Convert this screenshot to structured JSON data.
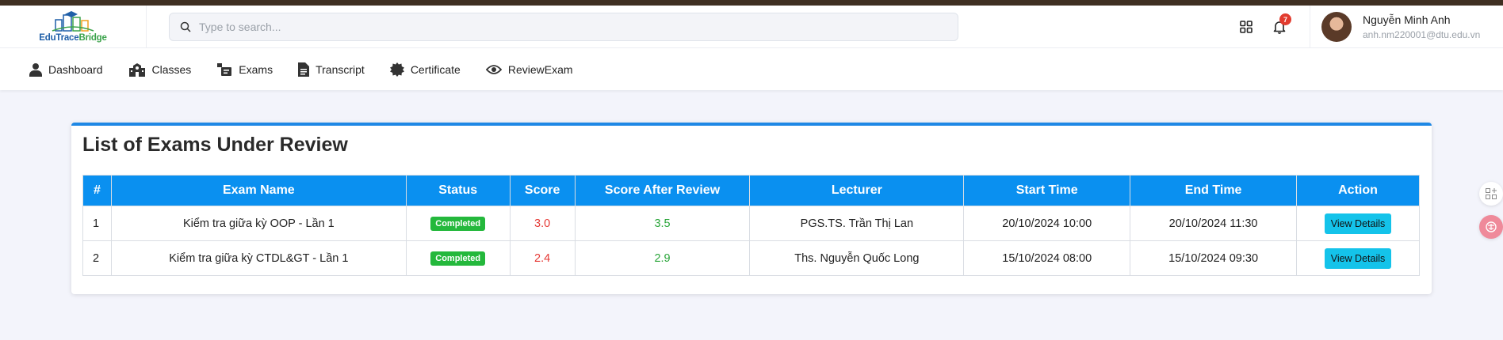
{
  "brand": {
    "logo_part1": "EduTrace",
    "logo_part2": "Bridge"
  },
  "search": {
    "placeholder": "Type to search..."
  },
  "header": {
    "notification_count": "7"
  },
  "user": {
    "name": "Nguyễn Minh Anh",
    "email": "anh.nm220001@dtu.edu.vn"
  },
  "nav": {
    "items": [
      {
        "label": "Dashboard",
        "icon": "user-icon"
      },
      {
        "label": "Classes",
        "icon": "school-icon"
      },
      {
        "label": "Exams",
        "icon": "exam-icon"
      },
      {
        "label": "Transcript",
        "icon": "document-icon"
      },
      {
        "label": "Certificate",
        "icon": "certificate-icon"
      },
      {
        "label": "ReviewExam",
        "icon": "eye-icon"
      }
    ]
  },
  "main": {
    "title": "List of Exams Under Review",
    "columns": [
      "#",
      "Exam Name",
      "Status",
      "Score",
      "Score After Review",
      "Lecturer",
      "Start Time",
      "End Time",
      "Action"
    ],
    "rows": [
      {
        "index": "1",
        "exam_name": "Kiểm tra giữa kỳ OOP - Lần 1",
        "status": "Completed",
        "score": "3.0",
        "score_after": "3.5",
        "lecturer": "PGS.TS. Trần Thị Lan",
        "start": "20/10/2024 10:00",
        "end": "20/10/2024 11:30",
        "action": "View Details"
      },
      {
        "index": "2",
        "exam_name": "Kiểm tra giữa kỳ CTDL&GT - Lần 1",
        "status": "Completed",
        "score": "2.4",
        "score_after": "2.9",
        "lecturer": "Ths. Nguyễn Quốc Long",
        "start": "15/10/2024 08:00",
        "end": "15/10/2024 09:30",
        "action": "View Details"
      }
    ]
  },
  "colors": {
    "accent": "#0a90f0",
    "status_completed": "#24b83c",
    "score": "#e53935",
    "score_after": "#2aa53a",
    "button": "#14c3ea"
  }
}
